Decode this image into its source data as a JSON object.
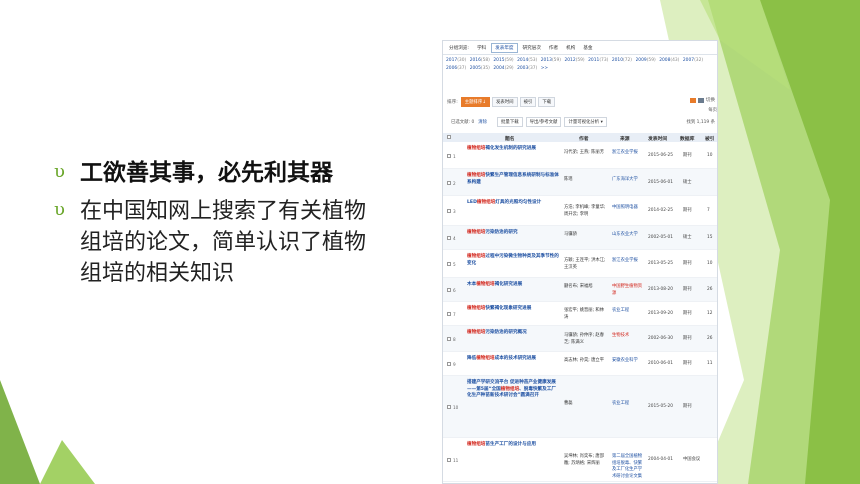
{
  "slide": {
    "bullets": [
      {
        "mark": "υ",
        "text": "工欲善其事，必先利其器"
      },
      {
        "mark": "υ",
        "text": "在中国知网上搜索了有关植物组培的论文，简单认识了植物组培的相关知识"
      }
    ]
  },
  "cnki": {
    "group_tabs": [
      {
        "label": "分组浏览:",
        "active": false
      },
      {
        "label": "学科",
        "active": false
      },
      {
        "label": "发表年度",
        "active": true
      },
      {
        "label": "研究层次",
        "active": false
      },
      {
        "label": "作者",
        "active": false
      },
      {
        "label": "机构",
        "active": false
      },
      {
        "label": "基金",
        "active": false
      }
    ],
    "years": [
      {
        "year": "2017",
        "count": "(30)"
      },
      {
        "year": "2016",
        "count": "(58)"
      },
      {
        "year": "2015",
        "count": "(59)"
      },
      {
        "year": "2014",
        "count": "(53)"
      },
      {
        "year": "2013",
        "count": "(59)"
      },
      {
        "year": "2012",
        "count": "(59)"
      },
      {
        "year": "2011",
        "count": "(73)"
      },
      {
        "year": "2010",
        "count": "(72)"
      },
      {
        "year": "2009",
        "count": "(59)"
      },
      {
        "year": "2008",
        "count": "(43)"
      },
      {
        "year": "2007",
        "count": "(32)"
      },
      {
        "year": "2006",
        "count": "(37)"
      },
      {
        "year": "2005",
        "count": "(35)"
      },
      {
        "year": "2004",
        "count": "(29)"
      },
      {
        "year": "2003",
        "count": "(37)"
      },
      {
        "year": ">>",
        "count": ""
      }
    ],
    "sort": {
      "label": "排序:",
      "buttons": [
        {
          "label": "主题排序↓",
          "active": true
        },
        {
          "label": "发表时间",
          "active": false
        },
        {
          "label": "被引",
          "active": false
        },
        {
          "label": "下载",
          "active": false
        }
      ],
      "view_label": "切换",
      "tail": "每页"
    },
    "actions": {
      "selected": "已选文献: 0",
      "clear": "清除",
      "buttons": [
        "批量下载",
        "导出/参考文献",
        "计量可视化分析 ▾"
      ],
      "found": "找到 1,119 条"
    },
    "headers": [
      "题名",
      "作者",
      "来源",
      "发表时间",
      "数据库",
      "被引"
    ],
    "rows": [
      {
        "n": "1",
        "title": [
          "植物组培",
          "褐化发生机制的研究进展"
        ],
        "author": "冯代弟; 王燕; 陈丽芳",
        "source": "浙江农业学报",
        "date": "2015-06-25",
        "db": "期刊",
        "cite": "10"
      },
      {
        "n": "2",
        "title": [
          "植物组培",
          "快繁生产管理信息系统研制与标准体系构建"
        ],
        "author": "陈瑶",
        "source": "广东海洋大学",
        "date": "2015-06-01",
        "db": "硕士",
        "cite": ""
      },
      {
        "n": "3",
        "title": [
          "LED",
          "植物组培",
          "灯具的光照均匀性设计"
        ],
        "author": "方浩; 李机峰; 李童华; 周开云; 李明",
        "source": "中国照明电器",
        "date": "2014-02-25",
        "db": "期刊",
        "cite": "7"
      },
      {
        "n": "4",
        "title": [
          "植物组培",
          "污染防治的研究"
        ],
        "author": "马骥骄",
        "source": "山东农业大学",
        "date": "2002-05-01",
        "db": "硕士",
        "cite": "15"
      },
      {
        "n": "5",
        "title": [
          "植物组培",
          "过程中污染微生物种类及其季节性的变化"
        ],
        "author": "方颖; 王连平; 洪木江; 王汉英",
        "source": "浙江农业学报",
        "date": "2013-05-25",
        "db": "期刊",
        "cite": "10"
      },
      {
        "n": "6",
        "title": [
          "木本",
          "植物组培",
          "褐化研究进展"
        ],
        "author": "蒯名布; 宋福旭",
        "source": "中国野生植物资源",
        "date": "2013-08-20",
        "db": "期刊",
        "cite": "26"
      },
      {
        "n": "7",
        "title": [
          "植物组培",
          "快繁褐化现象研究进展"
        ],
        "author": "张宏平; 姚晋丽; 和林涛",
        "source": "农业工程",
        "date": "2013-09-20",
        "db": "期刊",
        "cite": "12"
      },
      {
        "n": "8",
        "title": [
          "植物组培",
          "污染防治的研究概况"
        ],
        "author": "马骥骄; 孙仲序; 赵春芝; 陈满义",
        "source": "生物技术",
        "date": "2002-06-30",
        "db": "期刊",
        "cite": "26"
      },
      {
        "n": "9",
        "title": [
          "降低",
          "植物组培",
          "成本的技术研究进展"
        ],
        "author": "高志林; 孙昊; 唐立平",
        "source": "安徽农业科学",
        "date": "2010-06-01",
        "db": "期刊",
        "cite": "11"
      },
      {
        "n": "10",
        "title": [
          "搭建产学研交流平台 促进种苗产业健康发展——第5届“全国",
          "植物组培",
          "、脱毒快繁及工厂化生产种苗新技术研讨会”圆满召开"
        ],
        "author": "曹磊",
        "source": "农业工程",
        "date": "2015-05-20",
        "db": "期刊",
        "cite": ""
      },
      {
        "n": "11",
        "title": [
          "植物组培",
          "苗生产工厂的设计与应用"
        ],
        "author": "吴坤林; 肖奕布; 唐邵雕; 苏炳格; 宋辉丽",
        "source": "第二届全国植物组培脱毒、快繁及工厂化生产学术研讨会论文集",
        "date": "2004-04-01",
        "db": "中国会议",
        "cite": ""
      }
    ]
  },
  "colors": {
    "accent_green": "#8cc63f",
    "title_blue": "#1e50a2",
    "keyword_red": "#d2251b",
    "sort_orange": "#e87b2a"
  }
}
